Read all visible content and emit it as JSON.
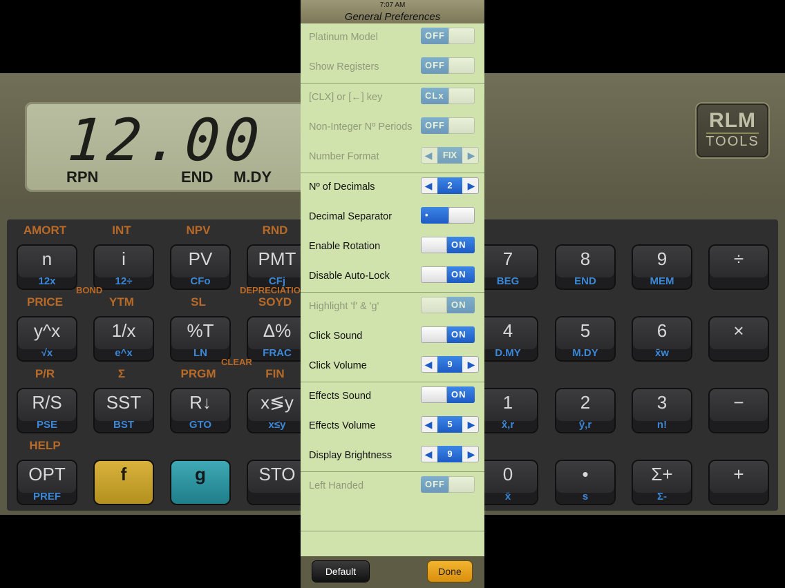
{
  "status_bar": {
    "time": "7:07 AM",
    "title": "General Preferences"
  },
  "calculator": {
    "display_value": "12.00",
    "annunciators": [
      "RPN",
      "END",
      "M.DY"
    ],
    "logo": {
      "top": "RLM",
      "bottom": "TOOLS"
    },
    "top_labels": [
      "AMORT",
      "INT",
      "NPV",
      "RND",
      "PRICE",
      "YTM",
      "SL",
      "SOYD",
      "P/R",
      "Σ",
      "PRGM",
      "FIN",
      "HELP"
    ],
    "group_labels": [
      "BOND",
      "DEPRECIATION",
      "CLEAR"
    ],
    "keys": [
      {
        "main": "n",
        "sub": "12x"
      },
      {
        "main": "i",
        "sub": "12÷"
      },
      {
        "main": "PV",
        "sub": "CFo"
      },
      {
        "main": "PMT",
        "sub": "CFj"
      },
      {
        "main": "7",
        "sub": "BEG"
      },
      {
        "main": "8",
        "sub": "END"
      },
      {
        "main": "9",
        "sub": "MEM"
      },
      {
        "main": "÷",
        "sub": ""
      },
      {
        "main": "y^x",
        "sub": "√x"
      },
      {
        "main": "1/x",
        "sub": "e^x"
      },
      {
        "main": "%T",
        "sub": "LN"
      },
      {
        "main": "Δ%",
        "sub": "FRAC"
      },
      {
        "main": "4",
        "sub": "D.MY"
      },
      {
        "main": "5",
        "sub": "M.DY"
      },
      {
        "main": "6",
        "sub": "x̄w"
      },
      {
        "main": "×",
        "sub": ""
      },
      {
        "main": "R/S",
        "sub": "PSE"
      },
      {
        "main": "SST",
        "sub": "BST"
      },
      {
        "main": "R↓",
        "sub": "GTO"
      },
      {
        "main": "x≶y",
        "sub": "x≤y"
      },
      {
        "main": "1",
        "sub": "x̂,r"
      },
      {
        "main": "2",
        "sub": "ŷ,r"
      },
      {
        "main": "3",
        "sub": "n!"
      },
      {
        "main": "−",
        "sub": ""
      },
      {
        "main": "OPT",
        "sub": "PREF"
      },
      {
        "main": "f",
        "sub": ""
      },
      {
        "main": "g",
        "sub": ""
      },
      {
        "main": "STO",
        "sub": ""
      },
      {
        "main": "0",
        "sub": "x̄"
      },
      {
        "main": "•",
        "sub": "s"
      },
      {
        "main": "Σ+",
        "sub": "Σ-"
      },
      {
        "main": "+",
        "sub": ""
      }
    ]
  },
  "preferences": [
    {
      "label": "Platinum Model",
      "control": "toggle",
      "state": "off",
      "value": "OFF",
      "enabled": false
    },
    {
      "label": "Show Registers",
      "control": "toggle",
      "state": "off",
      "value": "OFF",
      "enabled": false
    },
    {
      "label": "[CLX] or [←] key",
      "control": "toggle",
      "state": "off",
      "value": "CLx",
      "enabled": false
    },
    {
      "label": "Non-Integer Nº Periods",
      "control": "toggle",
      "state": "off",
      "value": "OFF",
      "enabled": false
    },
    {
      "label": "Number Format",
      "control": "stepper",
      "value": "FIX",
      "enabled": false
    },
    {
      "label": "Nº of Decimals",
      "control": "stepper",
      "value": "2",
      "enabled": true
    },
    {
      "label": "Decimal Separator",
      "control": "toggle",
      "state": "off",
      "value": "•",
      "enabled": true
    },
    {
      "label": "Enable Rotation",
      "control": "toggle",
      "state": "on",
      "value": "ON",
      "enabled": true
    },
    {
      "label": "Disable Auto-Lock",
      "control": "toggle",
      "state": "on",
      "value": "ON",
      "enabled": true
    },
    {
      "label": "Highlight 'f' & 'g'",
      "control": "toggle",
      "state": "on",
      "value": "ON",
      "enabled": false
    },
    {
      "label": "Click Sound",
      "control": "toggle",
      "state": "on",
      "value": "ON",
      "enabled": true
    },
    {
      "label": "Click Volume",
      "control": "stepper",
      "value": "9",
      "enabled": true
    },
    {
      "label": "Effects Sound",
      "control": "toggle",
      "state": "on",
      "value": "ON",
      "enabled": true
    },
    {
      "label": "Effects Volume",
      "control": "stepper",
      "value": "5",
      "enabled": true
    },
    {
      "label": "Display Brightness",
      "control": "stepper",
      "value": "9",
      "enabled": true
    },
    {
      "label": "Left Handed",
      "control": "toggle",
      "state": "off",
      "value": "OFF",
      "enabled": false
    }
  ],
  "stepper_arrows": {
    "left": "◀",
    "right": "▶"
  },
  "buttons": {
    "default": "Default",
    "done": "Done"
  },
  "colors": {
    "panel_bg": "#d0e3ac",
    "toggle_blue": "#1d5bc5",
    "done_orange": "#e9a31f"
  }
}
